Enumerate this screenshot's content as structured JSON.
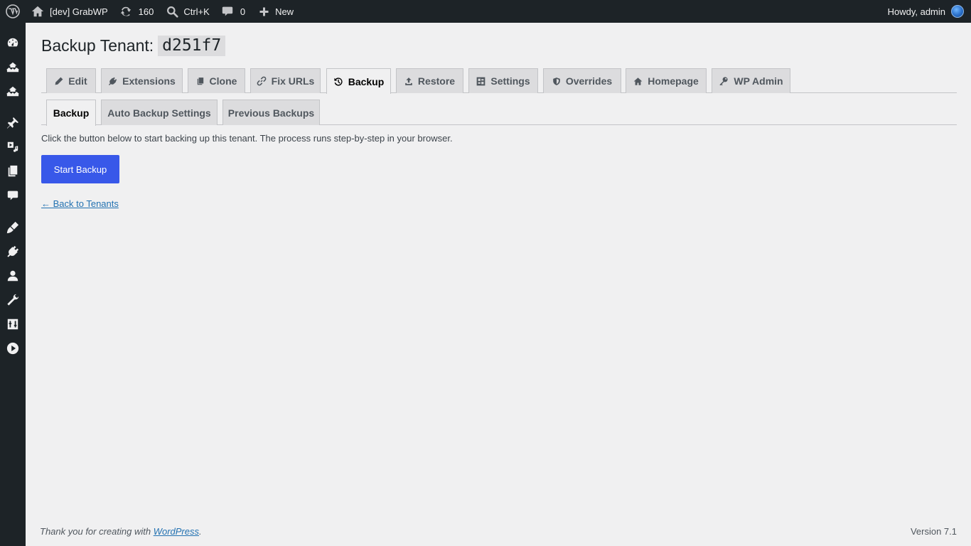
{
  "adminbar": {
    "site_name": "[dev] GrabWP",
    "updates_count": "160",
    "search_shortcut": "Ctrl+K",
    "comments_count": "0",
    "new_label": "New",
    "greeting": "Howdy, admin"
  },
  "sidebar": {
    "icons": [
      "dashboard-icon",
      "network-icon",
      "network-icon",
      "pin-icon",
      "media-icon",
      "pages-icon",
      "comments-icon",
      "appearance-icon",
      "plugins-icon",
      "users-icon",
      "tools-icon",
      "settings-icon",
      "play-icon"
    ]
  },
  "page": {
    "title_prefix": "Backup Tenant:",
    "tenant_id": "d251f7"
  },
  "tabs": [
    {
      "label": "Edit",
      "icon": "pencil-icon"
    },
    {
      "label": "Extensions",
      "icon": "plug-icon"
    },
    {
      "label": "Clone",
      "icon": "copy-icon"
    },
    {
      "label": "Fix URLs",
      "icon": "link-icon"
    },
    {
      "label": "Backup",
      "icon": "history-icon",
      "active": true
    },
    {
      "label": "Restore",
      "icon": "upload-icon"
    },
    {
      "label": "Settings",
      "icon": "grid-icon"
    },
    {
      "label": "Overrides",
      "icon": "shield-icon"
    },
    {
      "label": "Homepage",
      "icon": "home-icon"
    },
    {
      "label": "WP Admin",
      "icon": "key-icon"
    }
  ],
  "subtabs": [
    {
      "label": "Backup",
      "active": true
    },
    {
      "label": "Auto Backup Settings"
    },
    {
      "label": "Previous Backups"
    }
  ],
  "main": {
    "description": "Click the button below to start backing up this tenant. The process runs step-by-step in your browser.",
    "start_button": "Start Backup",
    "back_link": "← Back to Tenants"
  },
  "footer": {
    "thanks_prefix": "Thank you for creating with",
    "wordpress_link": "WordPress",
    "thanks_suffix": ".",
    "version": "Version 7.1"
  },
  "colors": {
    "primary": "#3858e9",
    "link": "#2271b1",
    "admin_bar": "#1d2327",
    "background": "#f0f0f1"
  }
}
